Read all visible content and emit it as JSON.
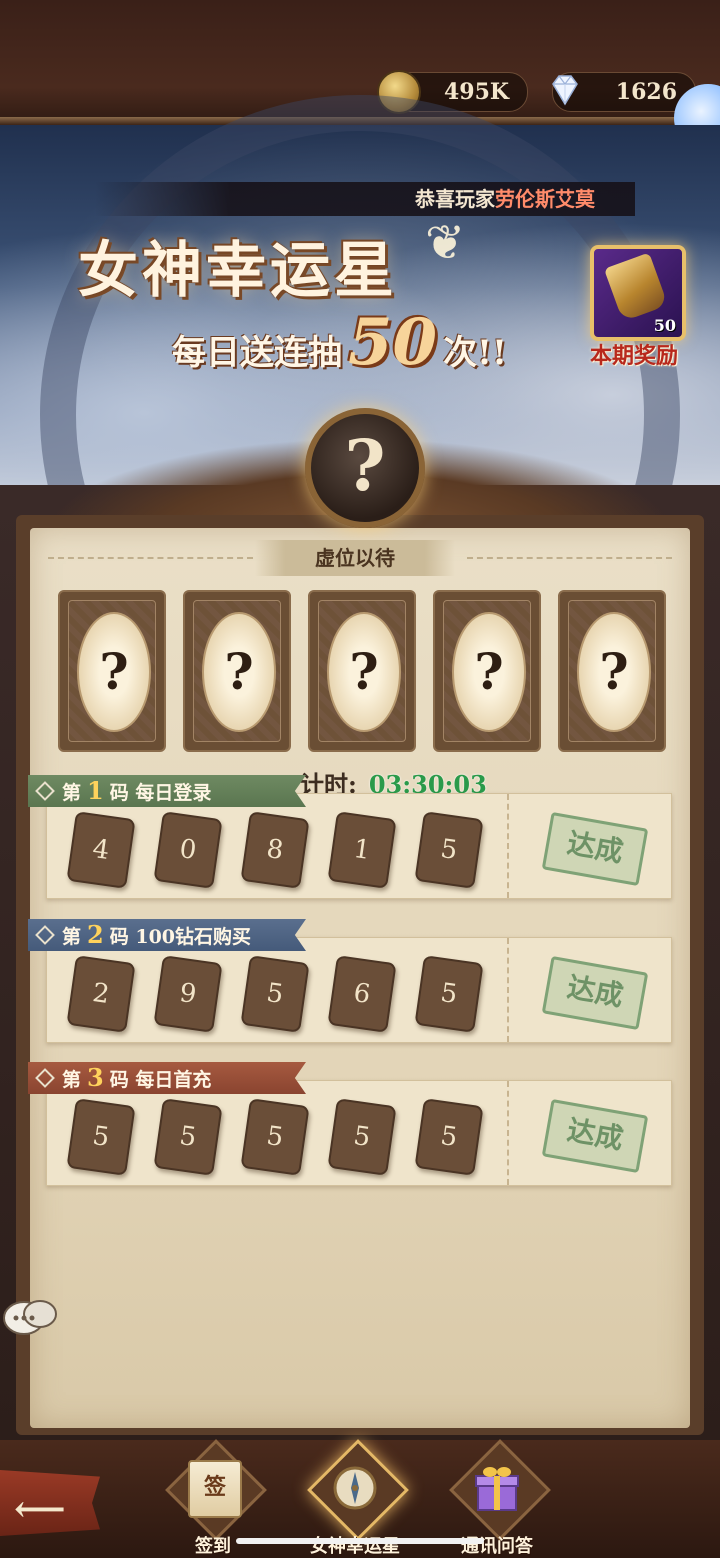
{
  "resources": {
    "coins": "495K",
    "diamonds": "1626"
  },
  "banner": {
    "ticker_prefix": "恭喜玩家",
    "ticker_player": "劳伦斯艾莫",
    "title": "女神幸运星",
    "subtitle_pre": "每日送连抽",
    "subtitle_number": "50",
    "subtitle_post": "次!!",
    "reward_count": "50",
    "reward_label": "本期奖励"
  },
  "mystery_symbol": "?",
  "panel": {
    "section_title": "虚位以待",
    "cards": [
      "?",
      "?",
      "?",
      "?",
      "?"
    ],
    "countdown_label": "计时:",
    "countdown_time": "03:30:03"
  },
  "codes": [
    {
      "prefix": "第",
      "index": "1",
      "suffix": "码",
      "task": "每日登录",
      "digits": [
        "4",
        "0",
        "8",
        "1",
        "5"
      ],
      "status": "达成",
      "ribbon_color": "#6f8a62"
    },
    {
      "prefix": "第",
      "index": "2",
      "suffix": "码",
      "task": "100钻石购买",
      "digits": [
        "2",
        "9",
        "5",
        "6",
        "5"
      ],
      "status": "达成",
      "ribbon_color": "#5a6f8e"
    },
    {
      "prefix": "第",
      "index": "3",
      "suffix": "码",
      "task": "每日首充",
      "digits": [
        "5",
        "5",
        "5",
        "5",
        "5"
      ],
      "status": "达成",
      "ribbon_color": "#a65a40"
    }
  ],
  "nav": {
    "items": [
      {
        "label": "签到",
        "icon": "scroll-icon",
        "active": false
      },
      {
        "label": "女神幸运星",
        "icon": "compass-icon",
        "active": true
      },
      {
        "label": "通讯问答",
        "icon": "gift-box-icon",
        "active": false
      }
    ],
    "scroll_glyph": "签"
  }
}
